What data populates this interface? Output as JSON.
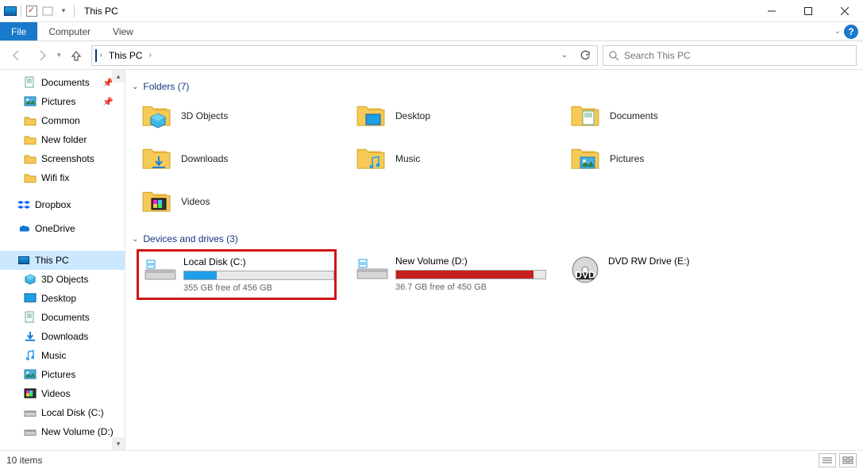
{
  "window": {
    "title": "This PC"
  },
  "ribbon": {
    "file": "File",
    "tabs": [
      "Computer",
      "View"
    ]
  },
  "address": {
    "crumbs": [
      "This PC"
    ]
  },
  "search": {
    "placeholder": "Search This PC"
  },
  "sidebar": {
    "quick": [
      {
        "label": "Documents",
        "icon": "documents",
        "pinned": true
      },
      {
        "label": "Pictures",
        "icon": "pictures",
        "pinned": true
      },
      {
        "label": "Common",
        "icon": "folder",
        "pinned": false
      },
      {
        "label": "New folder",
        "icon": "folder",
        "pinned": false
      },
      {
        "label": "Screenshots",
        "icon": "folder",
        "pinned": false
      },
      {
        "label": "Wifi fix",
        "icon": "folder",
        "pinned": false
      }
    ],
    "clouds": [
      {
        "label": "Dropbox",
        "icon": "dropbox"
      },
      {
        "label": "OneDrive",
        "icon": "onedrive"
      }
    ],
    "thispc": {
      "label": "This PC",
      "children": [
        {
          "label": "3D Objects",
          "icon": "3d"
        },
        {
          "label": "Desktop",
          "icon": "desktop"
        },
        {
          "label": "Documents",
          "icon": "documents"
        },
        {
          "label": "Downloads",
          "icon": "downloads"
        },
        {
          "label": "Music",
          "icon": "music"
        },
        {
          "label": "Pictures",
          "icon": "pictures"
        },
        {
          "label": "Videos",
          "icon": "videos"
        },
        {
          "label": "Local Disk (C:)",
          "icon": "disk"
        },
        {
          "label": "New Volume (D:)",
          "icon": "disk"
        }
      ]
    }
  },
  "groups": {
    "folders": {
      "title": "Folders (7)",
      "items": [
        {
          "label": "3D Objects",
          "icon": "3d"
        },
        {
          "label": "Desktop",
          "icon": "desktop"
        },
        {
          "label": "Documents",
          "icon": "documents"
        },
        {
          "label": "Downloads",
          "icon": "downloads"
        },
        {
          "label": "Music",
          "icon": "music"
        },
        {
          "label": "Pictures",
          "icon": "pictures"
        },
        {
          "label": "Videos",
          "icon": "videos"
        }
      ]
    },
    "drives": {
      "title": "Devices and drives (3)",
      "items": [
        {
          "label": "Local Disk (C:)",
          "free": "355 GB free of 456 GB",
          "fill_pct": 22,
          "fill_color": "#1e9fe8",
          "highlight": true,
          "kind": "hdd"
        },
        {
          "label": "New Volume (D:)",
          "free": "36.7 GB free of 450 GB",
          "fill_pct": 92,
          "fill_color": "#c61f1f",
          "highlight": false,
          "kind": "hdd"
        },
        {
          "label": "DVD RW Drive (E:)",
          "free": "",
          "fill_pct": 0,
          "fill_color": "",
          "highlight": false,
          "kind": "dvd"
        }
      ]
    }
  },
  "status": {
    "text": "10 items"
  }
}
